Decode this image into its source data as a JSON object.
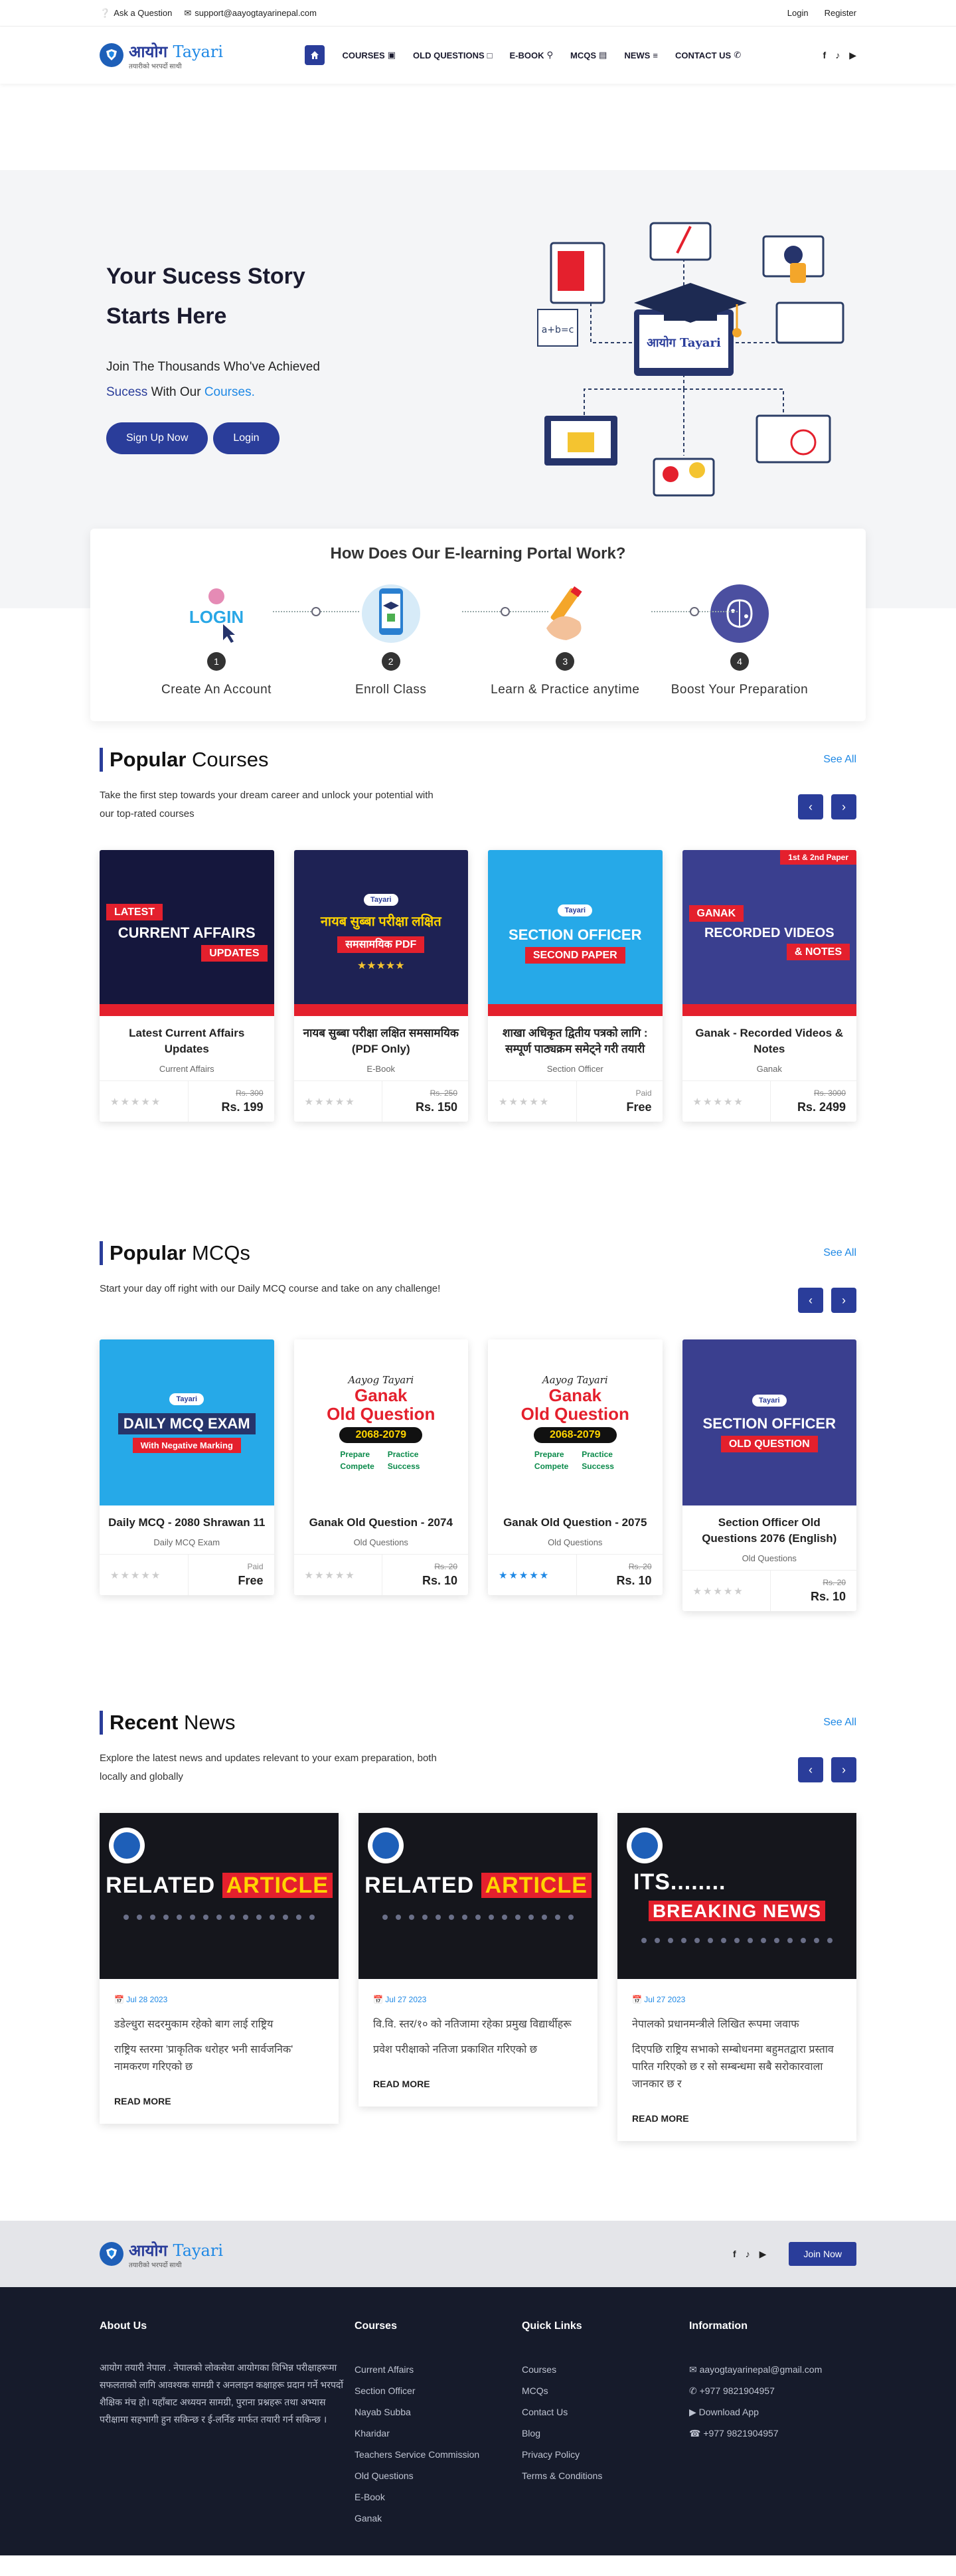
{
  "topbar": {
    "ask": "Ask a Question",
    "email": "support@aayogtayarinepal.com",
    "login": "Login",
    "register": "Register"
  },
  "brand": {
    "main": "आयोग",
    "accent": "Tayari",
    "tagline": "तयारीको भरपर्दो साथी"
  },
  "nav": {
    "items": [
      {
        "label": "COURSES"
      },
      {
        "label": "OLD QUESTIONS"
      },
      {
        "label": "E-BOOK"
      },
      {
        "label": "MCQS"
      },
      {
        "label": "NEWS"
      },
      {
        "label": "CONTACT US"
      }
    ]
  },
  "hero": {
    "title_line1": "Your Sucess Story",
    "title_line2": "Starts Here",
    "desc_line1": "Join The Thousands Who've Achieved",
    "desc_sucess": "Sucess",
    "desc_with": "With Our",
    "desc_courses": "Courses.",
    "signup": "Sign Up Now",
    "login": "Login"
  },
  "steps": {
    "title": "How Does Our E-learning Portal Work?",
    "items": [
      {
        "num": "1",
        "label": "Create An Account",
        "icon_text": "LOGIN"
      },
      {
        "num": "2",
        "label": "Enroll Class"
      },
      {
        "num": "3",
        "label": "Learn & Practice anytime"
      },
      {
        "num": "4",
        "label": "Boost Your Preparation"
      }
    ]
  },
  "courses": {
    "title_bold": "Popular",
    "title_rest": "Courses",
    "see_all": "See All",
    "desc": "Take the first step towards your dream career and unlock your potential with our top-rated courses",
    "items": [
      {
        "title": "Latest Current Affairs Updates",
        "category": "Current Affairs",
        "old_price": "Rs. 300",
        "price": "Rs. 199",
        "thumb_a": "LATEST",
        "thumb_b": "CURRENT AFFAIRS",
        "thumb_c": "UPDATES"
      },
      {
        "title": "नायब सुब्बा परीक्षा लक्षित समसामयिक (PDF Only)",
        "category": "E-Book",
        "old_price": "Rs. 250",
        "price": "Rs. 150",
        "thumb_a": "नायब सुब्बा परीक्षा लक्षित",
        "thumb_b": "समसामयिक PDF"
      },
      {
        "title": "शाखा अधिकृत द्वितीय पत्रको लागि : सम्पूर्ण पाठ्यक्रम समेट्ने गरी तयारी",
        "category": "Section Officer",
        "old_price": "Paid",
        "price": "Free",
        "thumb_a": "SECTION OFFICER",
        "thumb_b": "SECOND PAPER"
      },
      {
        "title": "Ganak - Recorded Videos & Notes",
        "category": "Ganak",
        "old_price": "Rs. 3000",
        "price": "Rs. 2499",
        "thumb_tag": "1st & 2nd Paper",
        "thumb_a": "GANAK",
        "thumb_b": "RECORDED VIDEOS",
        "thumb_c": "& NOTES"
      }
    ]
  },
  "mcqs": {
    "title_bold": "Popular",
    "title_rest": "MCQs",
    "see_all": "See All",
    "desc": "Start your day off right with our Daily MCQ course and take on any challenge!",
    "items": [
      {
        "title": "Daily MCQ - 2080 Shrawan 11",
        "category": "Daily MCQ Exam",
        "old_price": "Paid",
        "price": "Free",
        "thumb_a": "DAILY MCQ EXAM",
        "thumb_b": "With Negative Marking"
      },
      {
        "title": "Ganak Old Question - 2074",
        "category": "Old Questions",
        "old_price": "Rs. 20",
        "price": "Rs. 10",
        "thumb_script": "Aayog Tayari",
        "thumb_a": "Ganak",
        "thumb_b": "Old Question",
        "thumb_c": "2068-2079",
        "checks": [
          "Prepare",
          "Practice",
          "Compete",
          "Success"
        ]
      },
      {
        "title": "Ganak Old Question - 2075",
        "category": "Old Questions",
        "old_price": "Rs. 20",
        "price": "Rs. 10",
        "thumb_script": "Aayog Tayari",
        "thumb_a": "Ganak",
        "thumb_b": "Old Question",
        "thumb_c": "2068-2079",
        "checks": [
          "Prepare",
          "Practice",
          "Compete",
          "Success"
        ]
      },
      {
        "title": "Section Officer Old Questions 2076 (English)",
        "category": "Old Questions",
        "old_price": "Rs. 20",
        "price": "Rs. 10",
        "thumb_a": "SECTION OFFICER",
        "thumb_b": "OLD QUESTION"
      }
    ]
  },
  "news": {
    "title_bold": "Recent",
    "title_rest": "News",
    "see_all": "See All",
    "desc": "Explore the latest news and updates relevant to your exam preparation, both locally and globally",
    "items": [
      {
        "date": "Jul 28 2023",
        "title": "डडेल्धुरा सदरमुकाम रहेको बाग लाई राष्ट्रिय",
        "text": "राष्ट्रिय स्तरमा 'प्राकृतिक धरोहर भनी सार्वजनिक' नामकरण गरिएको छ",
        "read_more": "READ MORE",
        "img_a": "RELATED",
        "img_b": "ARTICLE"
      },
      {
        "date": "Jul 27 2023",
        "title": "वि.वि. स्तर/१० को नतिजामा रहेका प्रमुख विद्यार्थीहरू",
        "text": "प्रवेश परीक्षाको नतिजा प्रकाशित गरिएको छ",
        "read_more": "READ MORE",
        "img_a": "RELATED",
        "img_b": "ARTICLE"
      },
      {
        "date": "Jul 27 2023",
        "title": "नेपालको प्रधानमन्त्रीले लिखित रूपमा जवाफ",
        "text": "दिएपछि राष्ट्रिय सभाको सम्बोधनमा बहुमतद्वारा प्रस्ताव पारित गरिएको छ र सो सम्बन्धमा सबै सरोकारवाला जानकार छ र",
        "read_more": "READ MORE",
        "img_a": "ITS........",
        "img_b": "BREAKING NEWS"
      }
    ]
  },
  "footer": {
    "join": "Join Now",
    "about_title": "About Us",
    "about_text": "आयोग तयारी नेपाल . नेपालको लोकसेवा आयोगका विभिन्न परीक्षाहरूमा सफलताको लागि आवश्यक सामग्री र अनलाइन कक्षाहरू प्रदान गर्ने भरपर्दो शैक्षिक मंच हो। यहाँबाट अध्ययन सामग्री, पुराना प्रश्नहरू तथा अभ्यास परीक्षामा सहभागी हुन सकिन्छ र ई-लर्निङ मार्फत तयारी गर्न सकिन्छ ।",
    "courses_title": "Courses",
    "courses": [
      "Current Affairs",
      "Section Officer",
      "Nayab Subba",
      "Kharidar",
      "Teachers Service Commission",
      "Old Questions",
      "E-Book",
      "Ganak"
    ],
    "links_title": "Quick Links",
    "links": [
      "Courses",
      "MCQs",
      "Contact Us",
      "Blog",
      "Privacy Policy",
      "Terms & Conditions"
    ],
    "info_title": "Information",
    "info": [
      "aayogtayarinepal@gmail.com",
      "+977 9821904957",
      "Download App",
      "+977 9821904957"
    ]
  }
}
